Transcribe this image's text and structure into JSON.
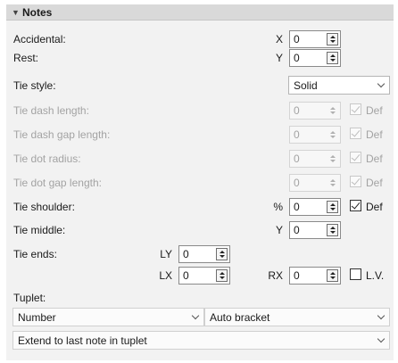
{
  "section": {
    "title": "Notes",
    "expanded": true
  },
  "fields": {
    "accidental": {
      "label": "Accidental:",
      "axis": "X",
      "value": "0"
    },
    "rest": {
      "label": "Rest:",
      "axis": "Y",
      "value": "0"
    },
    "tie_style": {
      "label": "Tie style:",
      "value": "Solid"
    },
    "tie_dash_length": {
      "label": "Tie dash length:",
      "value": "0",
      "def_label": "Def",
      "def_checked": true
    },
    "tie_dash_gap_length": {
      "label": "Tie dash gap length:",
      "value": "0",
      "def_label": "Def",
      "def_checked": true
    },
    "tie_dot_radius": {
      "label": "Tie dot radius:",
      "value": "0",
      "def_label": "Def",
      "def_checked": true
    },
    "tie_dot_gap_length": {
      "label": "Tie dot gap length:",
      "value": "0",
      "def_label": "Def",
      "def_checked": true
    },
    "tie_shoulder": {
      "label": "Tie shoulder:",
      "axis": "%",
      "value": "0",
      "def_label": "Def",
      "def_checked": true
    },
    "tie_middle": {
      "label": "Tie middle:",
      "axis": "Y",
      "value": "0"
    },
    "tie_ends": {
      "label": "Tie ends:",
      "ly_label": "LY",
      "ly_value": "0",
      "lx_label": "LX",
      "lx_value": "0",
      "rx_label": "RX",
      "rx_value": "0",
      "lv_label": "L.V.",
      "lv_checked": false
    },
    "tuplet": {
      "label": "Tuplet:",
      "number_value": "Number",
      "bracket_value": "Auto bracket",
      "extend_value": "Extend to last note in tuplet"
    }
  }
}
